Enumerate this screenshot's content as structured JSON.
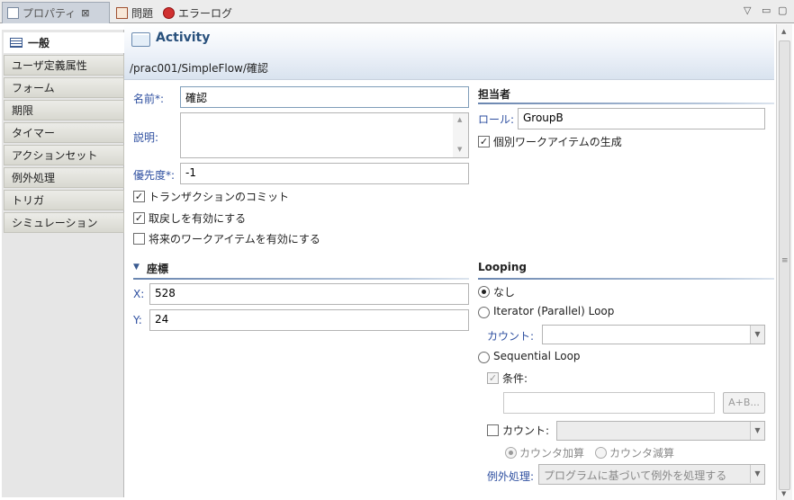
{
  "tabs": [
    {
      "label": "プロパティ",
      "close": "⊠"
    },
    {
      "label": "問題"
    },
    {
      "label": "エラーログ"
    }
  ],
  "nav": {
    "items": [
      "一般",
      "ユーザ定義属性",
      "フォーム",
      "期限",
      "タイマー",
      "アクションセット",
      "例外処理",
      "トリガ",
      "シミュレーション"
    ]
  },
  "header": {
    "title": "Activity",
    "path": "/prac001/SimpleFlow/確認"
  },
  "general": {
    "name_label": "名前*:",
    "name_value": "確認",
    "desc_label": "説明:",
    "priority_label": "優先度*:",
    "priority_value": "-1",
    "cb_transaction": "トランザクションのコミット",
    "cb_undo": "取戻しを有効にする",
    "cb_future": "将来のワークアイテムを有効にする"
  },
  "assignee": {
    "title": "担当者",
    "role_label": "ロール:",
    "role_value": "GroupB",
    "cb_individual": "個別ワークアイテムの生成"
  },
  "coords": {
    "title": "座標",
    "x_label": "X:",
    "x_value": "528",
    "y_label": "Y:",
    "y_value": "24"
  },
  "looping": {
    "title": "Looping",
    "opt_none": "なし",
    "opt_iterator": "Iterator (Parallel) Loop",
    "count_label": "カウント:",
    "opt_sequential": "Sequential Loop",
    "cond_label": "条件:",
    "ab_button": "A+B...",
    "count2_label": "カウント:",
    "opt_inc": "カウンタ加算",
    "opt_dec": "カウンタ減算",
    "exception_label": "例外処理:",
    "exception_value": "プログラムに基づいて例外を処理する"
  },
  "colors": {
    "accent": "#28507c",
    "label": "#2e4fa0"
  }
}
